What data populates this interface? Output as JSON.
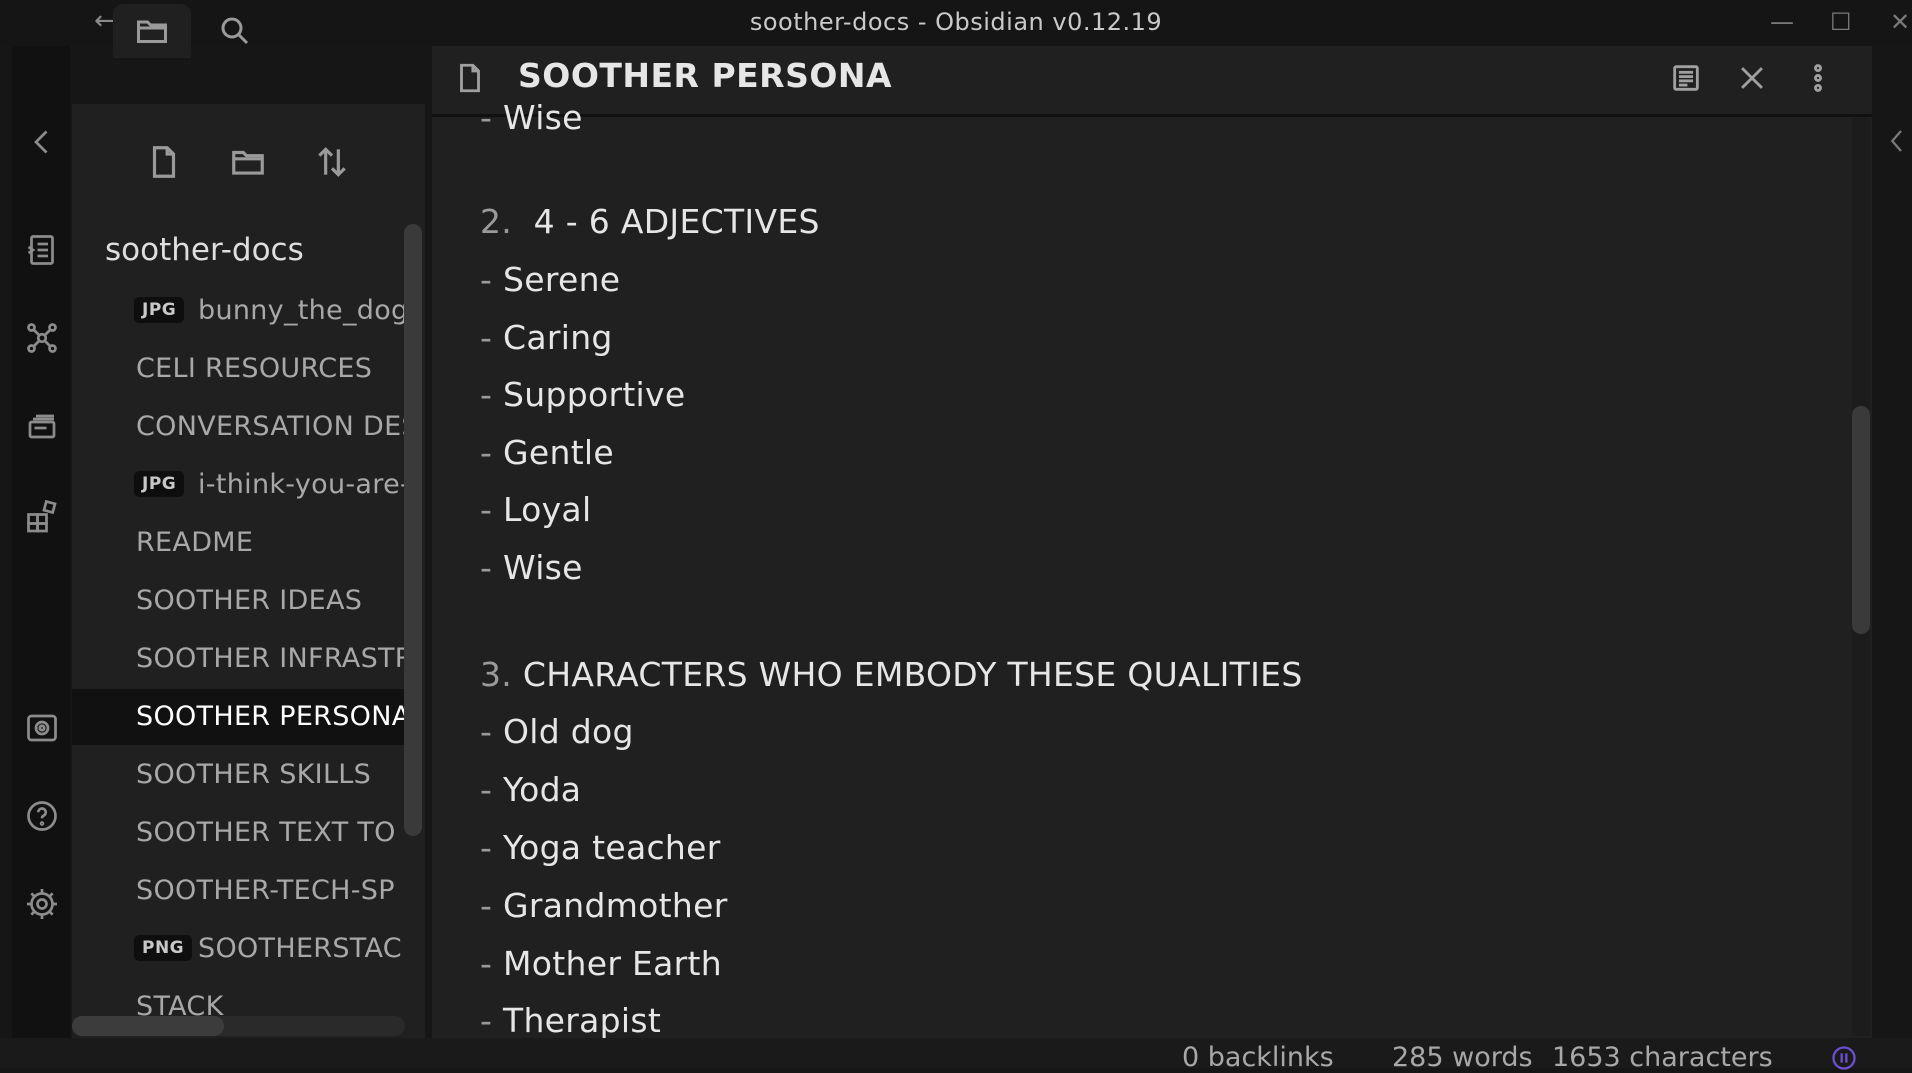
{
  "window": {
    "title": "soother-docs - Obsidian v0.12.19",
    "back_glyph": "←",
    "forward_glyph": "→",
    "minimize_glyph": "—",
    "maximize_glyph": "☐",
    "close_glyph": "✕"
  },
  "ribbon": {
    "icons": [
      "collapse-sidebar-icon",
      "open-quick-switcher-icon",
      "graph-view-icon",
      "open-cards-icon",
      "templates-icon",
      "open-vault-icon",
      "help-icon",
      "settings-icon"
    ]
  },
  "sidebar": {
    "tabs": [
      "file-explorer-icon",
      "search-icon"
    ],
    "tools": [
      "new-note-icon",
      "new-folder-icon",
      "sort-order-icon"
    ],
    "vault_name": "soother-docs",
    "files": [
      {
        "ext": "JPG",
        "name": "bunny_the_dog."
      },
      {
        "ext": "",
        "name": "CELI RESOURCES"
      },
      {
        "ext": "",
        "name": "CONVERSATION DES"
      },
      {
        "ext": "JPG",
        "name": "i-think-you-are-"
      },
      {
        "ext": "",
        "name": "README"
      },
      {
        "ext": "",
        "name": "SOOTHER IDEAS"
      },
      {
        "ext": "",
        "name": "SOOTHER INFRASTR"
      },
      {
        "ext": "",
        "name": "SOOTHER PERSONA"
      },
      {
        "ext": "",
        "name": "SOOTHER SKILLS"
      },
      {
        "ext": "",
        "name": "SOOTHER TEXT TO"
      },
      {
        "ext": "",
        "name": "SOOTHER-TECH-SP"
      },
      {
        "ext": "PNG",
        "name": "SOOTHERSTAC"
      },
      {
        "ext": "",
        "name": "STACK"
      }
    ],
    "active_file": "SOOTHER PERSONA"
  },
  "editor": {
    "title": "SOOTHER PERSONA",
    "header_icons": [
      "file-icon",
      "reading-mode-icon",
      "close-icon",
      "more-options-icon"
    ],
    "lines": [
      {
        "dash": "- ",
        "text": "Wise"
      },
      {
        "num": "2.  ",
        "text": "4 - 6 ADJECTIVES"
      },
      {
        "dash": "- ",
        "text": "Serene"
      },
      {
        "dash": "- ",
        "text": "Caring"
      },
      {
        "dash": "- ",
        "text": "Supportive"
      },
      {
        "dash": "- ",
        "text": "Gentle"
      },
      {
        "dash": "- ",
        "text": "Loyal"
      },
      {
        "dash": "- ",
        "text": "Wise"
      },
      {
        "num": "3. ",
        "text": "CHARACTERS WHO EMBODY THESE QUALITIES"
      },
      {
        "dash": "- ",
        "text": "Old dog"
      },
      {
        "dash": "- ",
        "text": "Yoda"
      },
      {
        "dash": "- ",
        "text": "Yoga teacher"
      },
      {
        "dash": "- ",
        "text": "Grandmother"
      },
      {
        "dash": "- ",
        "text": "Mother Earth"
      },
      {
        "dash": "- ",
        "text": "Therapist"
      }
    ]
  },
  "status": {
    "backlinks": "0 backlinks",
    "words": "285 words",
    "characters": "1653 characters"
  },
  "colors": {
    "background": "#202020",
    "sidebar_active": "#111111",
    "accent": "#7b5cd6"
  }
}
